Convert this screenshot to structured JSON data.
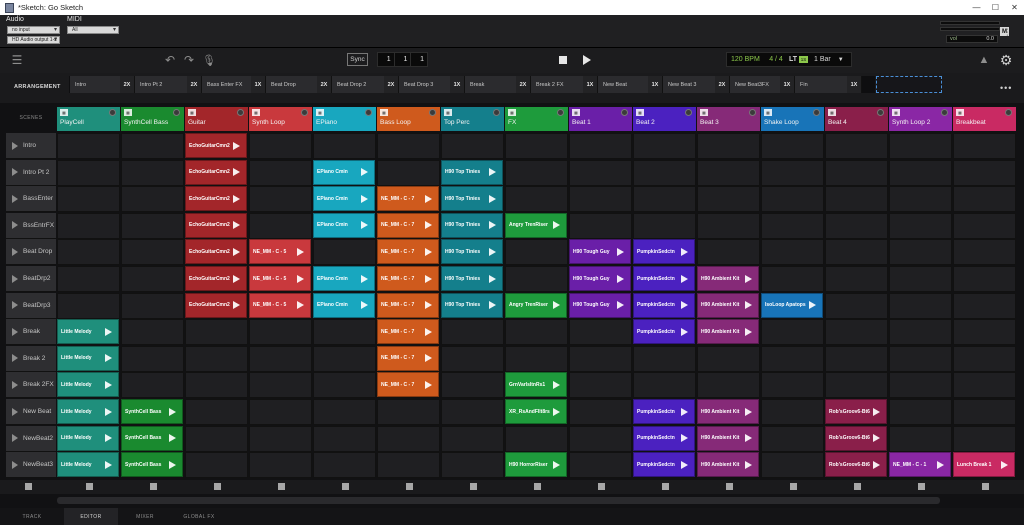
{
  "window": {
    "title": "*Sketch: Go Sketch"
  },
  "io": {
    "audio_label": "Audio",
    "audio_input": "no input",
    "audio_output": "HD Audio output 1-2",
    "midi_label": "MIDI",
    "midi_input": "All",
    "master_button": "M",
    "vol_label": "vol",
    "vol_value": "0.0"
  },
  "transport": {
    "sync_label": "Sync",
    "position": [
      "1",
      "1",
      "1"
    ],
    "bpm": "120 BPM",
    "time_signature": "4 / 4",
    "lt_label": "LT",
    "lt_value": "1S",
    "quantize": "1 Bar"
  },
  "arrangement": {
    "label": "ARRANGEMENT",
    "items": [
      {
        "name": "Intro",
        "repeat": "2X"
      },
      {
        "name": "Intro Pt 2",
        "repeat": "2X"
      },
      {
        "name": "Bass Enter FX",
        "repeat": "1X"
      },
      {
        "name": "Beat Drop",
        "repeat": "2X"
      },
      {
        "name": "Beat Drop 2",
        "repeat": "2X"
      },
      {
        "name": "Beat Drop 3",
        "repeat": "1X"
      },
      {
        "name": "Break",
        "repeat": "2X"
      },
      {
        "name": "Break 2 FX",
        "repeat": "1X"
      },
      {
        "name": "New Beat",
        "repeat": "1X"
      },
      {
        "name": "New Beat 3",
        "repeat": "2X"
      },
      {
        "name": "New Beat3FX",
        "repeat": "1X"
      },
      {
        "name": "Fin",
        "repeat": "1X"
      }
    ]
  },
  "grid": {
    "scenes_label": "SCENES",
    "tracks": [
      {
        "name": "PlayCell",
        "color": "#1f8f7c"
      },
      {
        "name": "SynthCell Bass",
        "color": "#1a8a2f"
      },
      {
        "name": "Guitar",
        "color": "#a3262a"
      },
      {
        "name": "Synth Loop",
        "color": "#c9393d"
      },
      {
        "name": "EPiano",
        "color": "#18a7bf"
      },
      {
        "name": "Bass Loop",
        "color": "#cf5a1d"
      },
      {
        "name": "Top Perc",
        "color": "#147f8c"
      },
      {
        "name": "FX",
        "color": "#1e9b3c"
      },
      {
        "name": "Beat 1",
        "color": "#6a1fa8"
      },
      {
        "name": "Beat 2",
        "color": "#4b21c0"
      },
      {
        "name": "Beat 3",
        "color": "#862a78"
      },
      {
        "name": "Shake Loop",
        "color": "#1874b8"
      },
      {
        "name": "Beat 4",
        "color": "#8a1f4a"
      },
      {
        "name": "Synth Loop 2",
        "color": "#8a27a5"
      },
      {
        "name": "Breakbeat",
        "color": "#c92a63"
      }
    ],
    "scenes": [
      "Intro",
      "Intro Pt 2",
      "BassEnter",
      "BssEntrFX",
      "Beat Drop",
      "BeatDrp2",
      "BeatDrp3",
      "Break",
      "Break 2",
      "Break 2FX",
      "New Beat",
      "NewBeat2",
      "NewBeat3"
    ],
    "clips": [
      {
        "row": 0,
        "col": 2,
        "name": "EchoGuitarCmn2",
        "color": "#a3262a"
      },
      {
        "row": 1,
        "col": 2,
        "name": "EchoGuitarCmn2",
        "color": "#a3262a"
      },
      {
        "row": 1,
        "col": 4,
        "name": "EPiano Cmin",
        "color": "#18a7bf"
      },
      {
        "row": 1,
        "col": 6,
        "name": "H90 Top Tinies",
        "color": "#147f8c"
      },
      {
        "row": 2,
        "col": 2,
        "name": "EchoGuitarCmn2",
        "color": "#a3262a"
      },
      {
        "row": 2,
        "col": 4,
        "name": "EPiano Cmin",
        "color": "#18a7bf"
      },
      {
        "row": 2,
        "col": 5,
        "name": "NE_MM - C - 7",
        "color": "#cf5a1d"
      },
      {
        "row": 2,
        "col": 6,
        "name": "H90 Top Tinies",
        "color": "#147f8c"
      },
      {
        "row": 3,
        "col": 2,
        "name": "EchoGuitarCmn2",
        "color": "#a3262a"
      },
      {
        "row": 3,
        "col": 4,
        "name": "EPiano Cmin",
        "color": "#18a7bf"
      },
      {
        "row": 3,
        "col": 5,
        "name": "NE_MM - C - 7",
        "color": "#cf5a1d"
      },
      {
        "row": 3,
        "col": 6,
        "name": "H90 Top Tinies",
        "color": "#147f8c"
      },
      {
        "row": 3,
        "col": 7,
        "name": "Angry TrenRiser",
        "color": "#1e9b3c"
      },
      {
        "row": 4,
        "col": 2,
        "name": "EchoGuitarCmn2",
        "color": "#a3262a"
      },
      {
        "row": 4,
        "col": 3,
        "name": "NE_MM - C - 5",
        "color": "#c9393d"
      },
      {
        "row": 4,
        "col": 5,
        "name": "NE_MM - C - 7",
        "color": "#cf5a1d"
      },
      {
        "row": 4,
        "col": 6,
        "name": "H90 Top Tinies",
        "color": "#147f8c"
      },
      {
        "row": 4,
        "col": 8,
        "name": "H90 Tough Guy",
        "color": "#6a1fa8"
      },
      {
        "row": 4,
        "col": 9,
        "name": "PumpkinSedctn",
        "color": "#4b21c0"
      },
      {
        "row": 5,
        "col": 2,
        "name": "EchoGuitarCmn2",
        "color": "#a3262a"
      },
      {
        "row": 5,
        "col": 3,
        "name": "NE_MM - C - 5",
        "color": "#c9393d"
      },
      {
        "row": 5,
        "col": 4,
        "name": "EPiano Cmin",
        "color": "#18a7bf"
      },
      {
        "row": 5,
        "col": 5,
        "name": "NE_MM - C - 7",
        "color": "#cf5a1d"
      },
      {
        "row": 5,
        "col": 6,
        "name": "H90 Top Tinies",
        "color": "#147f8c"
      },
      {
        "row": 5,
        "col": 8,
        "name": "H90 Tough Guy",
        "color": "#6a1fa8"
      },
      {
        "row": 5,
        "col": 9,
        "name": "PumpkinSedctn",
        "color": "#4b21c0"
      },
      {
        "row": 5,
        "col": 10,
        "name": "H90 Ambient Kit",
        "color": "#862a78"
      },
      {
        "row": 6,
        "col": 2,
        "name": "EchoGuitarCmn2",
        "color": "#a3262a"
      },
      {
        "row": 6,
        "col": 3,
        "name": "NE_MM - C - 5",
        "color": "#c9393d"
      },
      {
        "row": 6,
        "col": 4,
        "name": "EPiano Cmin",
        "color": "#18a7bf"
      },
      {
        "row": 6,
        "col": 5,
        "name": "NE_MM - C - 7",
        "color": "#cf5a1d"
      },
      {
        "row": 6,
        "col": 6,
        "name": "H90 Top Tinies",
        "color": "#147f8c"
      },
      {
        "row": 6,
        "col": 7,
        "name": "Angry TrenRiser",
        "color": "#1e9b3c"
      },
      {
        "row": 6,
        "col": 8,
        "name": "H90 Tough Guy",
        "color": "#6a1fa8"
      },
      {
        "row": 6,
        "col": 9,
        "name": "PumpkinSedctn",
        "color": "#4b21c0"
      },
      {
        "row": 6,
        "col": 10,
        "name": "H90 Ambient Kit",
        "color": "#862a78"
      },
      {
        "row": 6,
        "col": 11,
        "name": "IsoLoop Apatops",
        "color": "#1874b8"
      },
      {
        "row": 7,
        "col": 0,
        "name": "Little Melody",
        "color": "#1f8f7c"
      },
      {
        "row": 7,
        "col": 5,
        "name": "NE_MM - C - 7",
        "color": "#cf5a1d"
      },
      {
        "row": 7,
        "col": 9,
        "name": "PumpkinSedctn",
        "color": "#4b21c0"
      },
      {
        "row": 7,
        "col": 10,
        "name": "H90 Ambient Kit",
        "color": "#862a78"
      },
      {
        "row": 8,
        "col": 0,
        "name": "Little Melody",
        "color": "#1f8f7c"
      },
      {
        "row": 8,
        "col": 5,
        "name": "NE_MM - C - 7",
        "color": "#cf5a1d"
      },
      {
        "row": 9,
        "col": 0,
        "name": "Little Melody",
        "color": "#1f8f7c"
      },
      {
        "row": 9,
        "col": 5,
        "name": "NE_MM - C - 7",
        "color": "#cf5a1d"
      },
      {
        "row": 9,
        "col": 7,
        "name": "GrnVarIsltnRs1",
        "color": "#1e9b3c"
      },
      {
        "row": 10,
        "col": 0,
        "name": "Little Melody",
        "color": "#1f8f7c"
      },
      {
        "row": 10,
        "col": 1,
        "name": "SynthCell Bass",
        "color": "#1a8a2f"
      },
      {
        "row": 10,
        "col": 7,
        "name": "XR_RsAndFllt8rs",
        "color": "#1e9b3c"
      },
      {
        "row": 10,
        "col": 9,
        "name": "PumpkinSedctn",
        "color": "#4b21c0"
      },
      {
        "row": 10,
        "col": 10,
        "name": "H90 Ambient Kit",
        "color": "#862a78"
      },
      {
        "row": 10,
        "col": 12,
        "name": "Rob'sGroov6-Bt6",
        "color": "#8a1f4a"
      },
      {
        "row": 11,
        "col": 0,
        "name": "Little Melody",
        "color": "#1f8f7c"
      },
      {
        "row": 11,
        "col": 1,
        "name": "SynthCell Bass",
        "color": "#1a8a2f"
      },
      {
        "row": 11,
        "col": 9,
        "name": "PumpkinSedctn",
        "color": "#4b21c0"
      },
      {
        "row": 11,
        "col": 10,
        "name": "H90 Ambient Kit",
        "color": "#862a78"
      },
      {
        "row": 11,
        "col": 12,
        "name": "Rob'sGroov6-Bt6",
        "color": "#8a1f4a"
      },
      {
        "row": 12,
        "col": 0,
        "name": "Little Melody",
        "color": "#1f8f7c"
      },
      {
        "row": 12,
        "col": 1,
        "name": "SynthCell Bass",
        "color": "#1a8a2f"
      },
      {
        "row": 12,
        "col": 7,
        "name": "H90 HorrorRiser",
        "color": "#1e9b3c"
      },
      {
        "row": 12,
        "col": 9,
        "name": "PumpkinSedctn",
        "color": "#4b21c0"
      },
      {
        "row": 12,
        "col": 10,
        "name": "H90 Ambient Kit",
        "color": "#862a78"
      },
      {
        "row": 12,
        "col": 12,
        "name": "Rob'sGroov6-Bt6",
        "color": "#8a1f4a"
      },
      {
        "row": 12,
        "col": 13,
        "name": "NE_MM - C - 1",
        "color": "#8a27a5"
      },
      {
        "row": 12,
        "col": 14,
        "name": "Lunch Break 1",
        "color": "#c92a63"
      }
    ]
  },
  "tabs": [
    {
      "label": "TRACK",
      "active": false
    },
    {
      "label": "EDITOR",
      "active": true
    },
    {
      "label": "MIXER",
      "active": false
    },
    {
      "label": "GLOBAL FX",
      "active": false
    }
  ]
}
